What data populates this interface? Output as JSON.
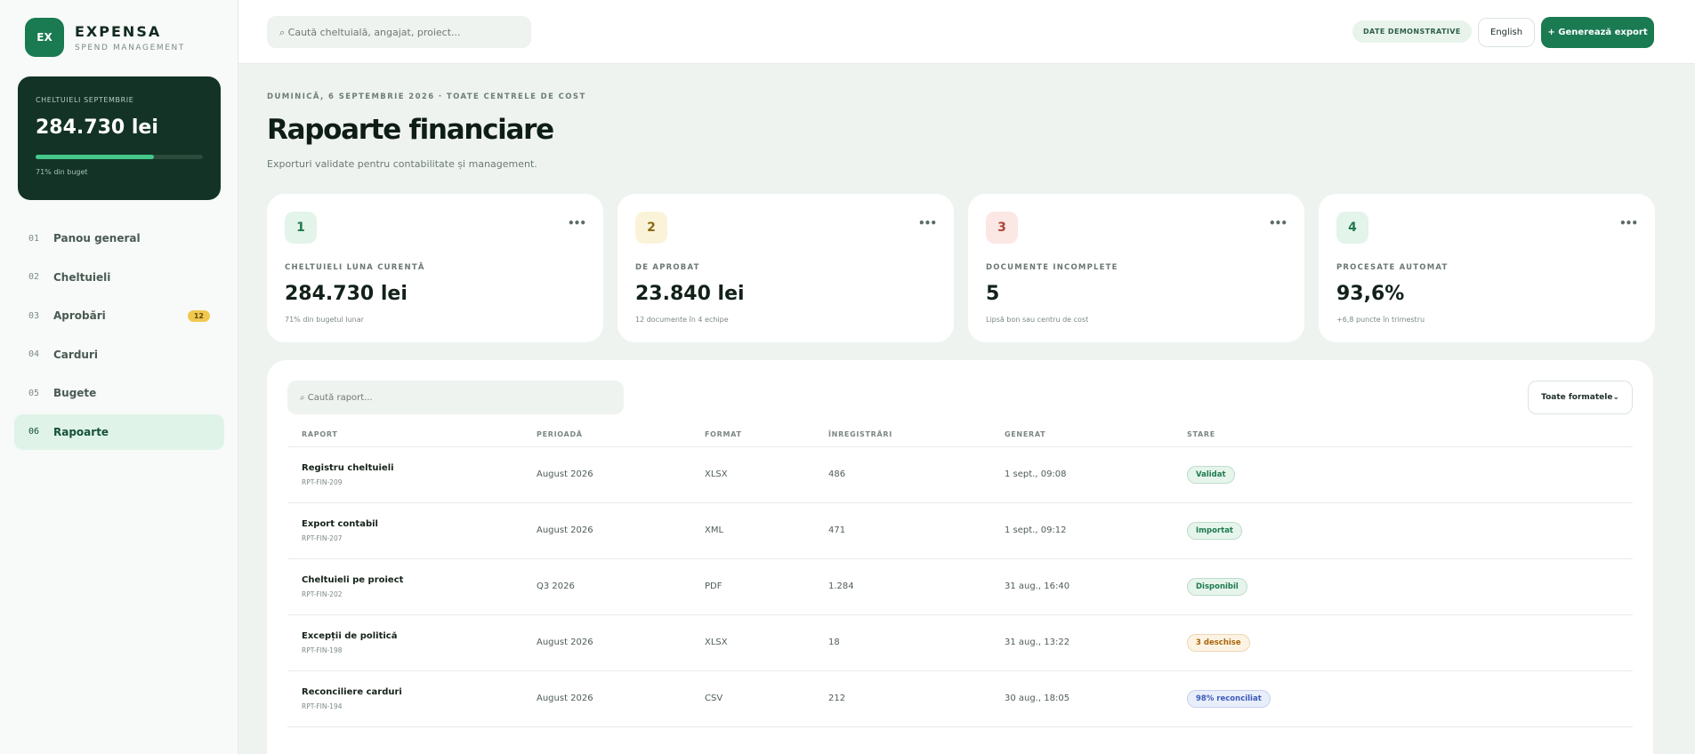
{
  "brand": {
    "initials": "EX",
    "name": "EXPENSA",
    "sub": "SPEND MANAGEMENT"
  },
  "spend": {
    "label": "CHELTUIELI SEPTEMBRIE",
    "value": "284.730 lei",
    "progress_percent": 71,
    "note": "71% din buget"
  },
  "nav": [
    {
      "num": "01",
      "label": "Panou general"
    },
    {
      "num": "02",
      "label": "Cheltuieli"
    },
    {
      "num": "03",
      "label": "Aprobări",
      "badge": "12"
    },
    {
      "num": "04",
      "label": "Carduri"
    },
    {
      "num": "05",
      "label": "Bugete"
    },
    {
      "num": "06",
      "label": "Rapoarte",
      "active": true
    }
  ],
  "topbar": {
    "search_placeholder": "⌕ Caută cheltuială, angajat, proiect...",
    "demo_badge": "DATE DEMONSTRATIVE",
    "language": "English",
    "export_label": "+ Generează export"
  },
  "page": {
    "crumb": "DUMINICĂ, 6 SEPTEMBRIE 2026 · TOATE CENTRELE DE COST",
    "title": "Rapoarte financiare",
    "subtitle": "Exporturi validate pentru contabilitate și management."
  },
  "stats": [
    {
      "icon": "1",
      "label": "CHELTUIELI LUNA CURENTĂ",
      "value": "284.730 lei",
      "note": "71% din bugetul lunar",
      "bg": "#e3f4ea",
      "fg": "#1f7a4f"
    },
    {
      "icon": "2",
      "label": "DE APROBAT",
      "value": "23.840 lei",
      "note": "12 documente în 4 echipe",
      "bg": "#fbf3d9",
      "fg": "#8a6a12"
    },
    {
      "icon": "3",
      "label": "DOCUMENTE INCOMPLETE",
      "value": "5",
      "note": "Lipsă bon sau centru de cost",
      "bg": "#fbe7e4",
      "fg": "#b0453a"
    },
    {
      "icon": "4",
      "label": "PROCESATE AUTOMAT",
      "value": "93,6%",
      "note": "+6,8 puncte în trimestru",
      "bg": "#e3f4ea",
      "fg": "#1f7a4f"
    }
  ],
  "stat_more": "•••",
  "reports": {
    "search_placeholder": "⌕ Caută raport...",
    "format_filter": "Toate formatele⌄",
    "columns": [
      "RAPORT",
      "PERIOADĂ",
      "FORMAT",
      "ÎNREGISTRĂRI",
      "GENERAT",
      "STARE"
    ],
    "rows": [
      {
        "name": "Registru cheltuieli",
        "id": "RPT-FIN-209",
        "period": "August 2026",
        "format": "XLSX",
        "records": "486",
        "generated": "1 sept., 09:08",
        "status": "Validat",
        "status_color": "#1f7a4f",
        "status_bg": "#e6f5ec"
      },
      {
        "name": "Export contabil",
        "id": "RPT-FIN-207",
        "period": "August 2026",
        "format": "XML",
        "records": "471",
        "generated": "1 sept., 09:12",
        "status": "Importat",
        "status_color": "#1f7a4f",
        "status_bg": "#e6f5ec"
      },
      {
        "name": "Cheltuieli pe proiect",
        "id": "RPT-FIN-202",
        "period": "Q3 2026",
        "format": "PDF",
        "records": "1.284",
        "generated": "31 aug., 16:40",
        "status": "Disponibil",
        "status_color": "#1f7a4f",
        "status_bg": "#e6f5ec"
      },
      {
        "name": "Excepții de politică",
        "id": "RPT-FIN-198",
        "period": "August 2026",
        "format": "XLSX",
        "records": "18",
        "generated": "31 aug., 13:22",
        "status": "3 deschise",
        "status_color": "#a8660f",
        "status_bg": "#fdf3e2"
      },
      {
        "name": "Reconciliere carduri",
        "id": "RPT-FIN-194",
        "period": "August 2026",
        "format": "CSV",
        "records": "212",
        "generated": "30 aug., 18:05",
        "status": "98% reconciliat",
        "status_color": "#3b5bb8",
        "status_bg": "#e9eefb"
      }
    ]
  },
  "colors": {
    "accent": "#1a7a52",
    "dark_card": "#123326",
    "progress": "#46c78a",
    "badge": "#f1c84e"
  }
}
